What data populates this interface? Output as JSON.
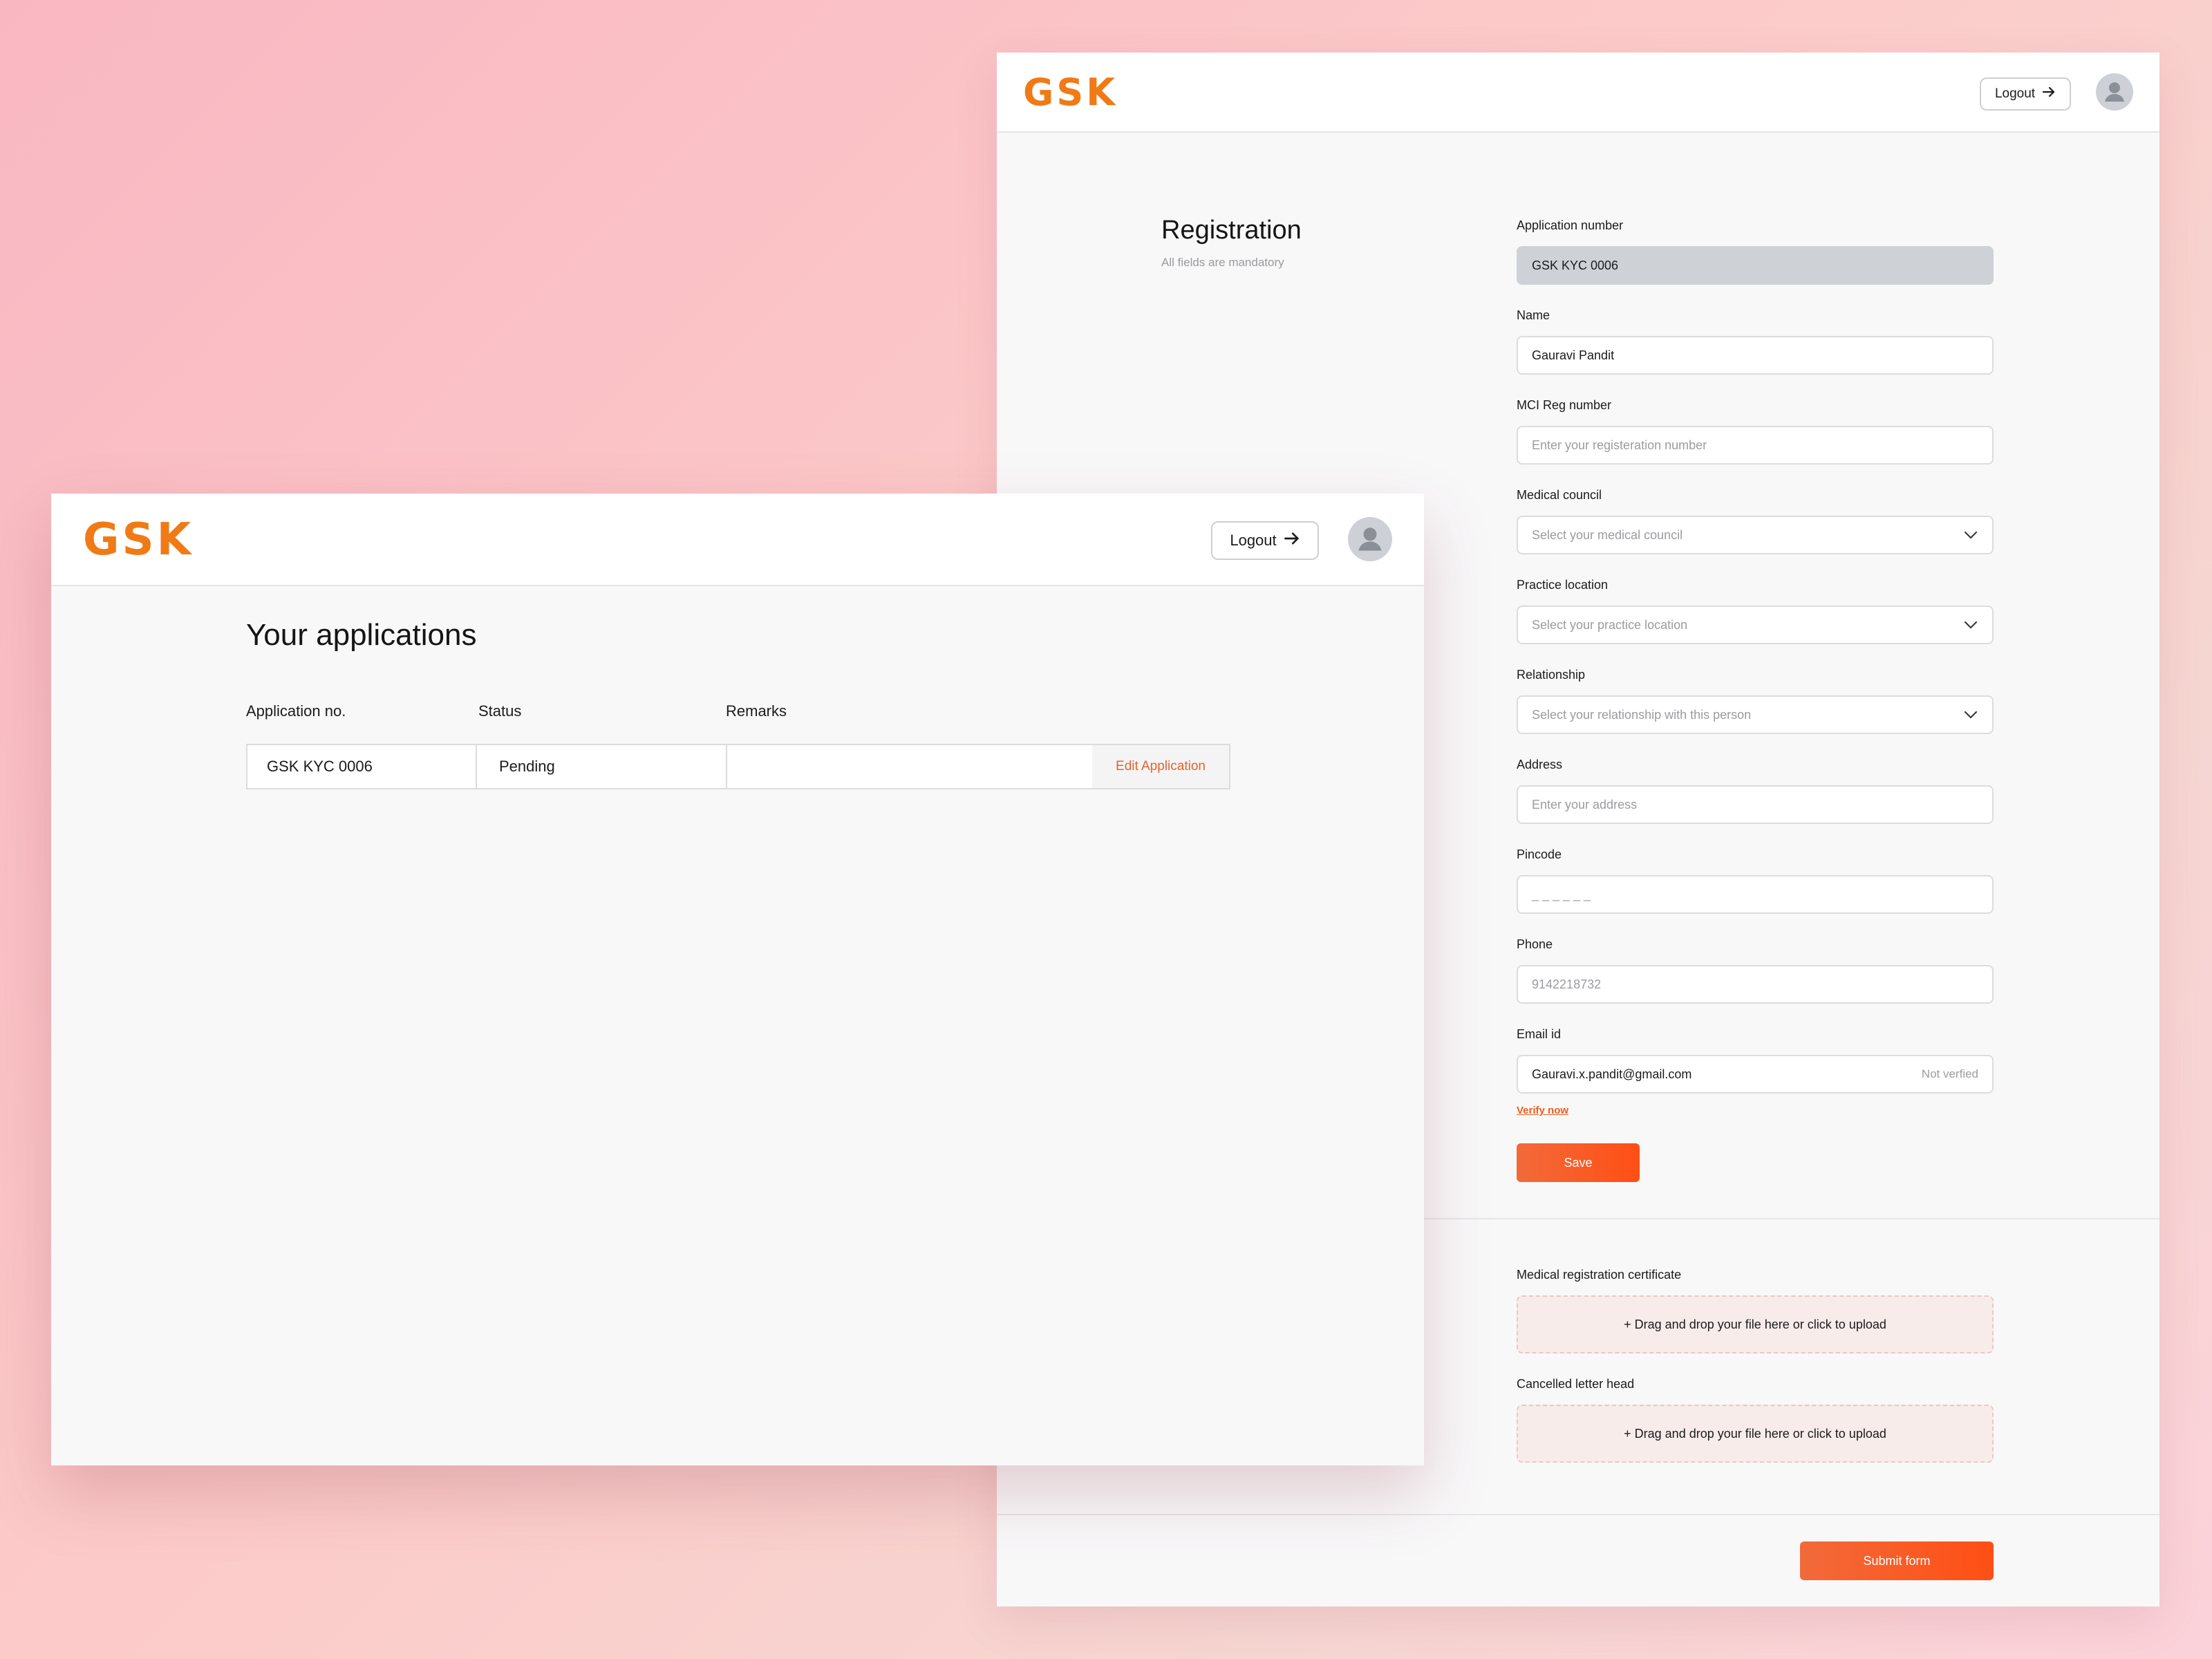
{
  "registration": {
    "brand": "GSK",
    "logout_label": "Logout",
    "title": "Registration",
    "subtitle": "All fields are mandatory",
    "fields": [
      {
        "label": "Application number",
        "value": "GSK KYC 0006"
      },
      {
        "label": "Name",
        "value": "Gauravi Pandit"
      },
      {
        "label": "MCI Reg number",
        "placeholder": "Enter your registeration number"
      },
      {
        "label": "Medical council",
        "placeholder": "Select your medical council"
      },
      {
        "label": "Practice location",
        "placeholder": "Select your practice location"
      },
      {
        "label": "Relationship",
        "placeholder": "Select your relationship with this person"
      },
      {
        "label": "Address",
        "placeholder": "Enter your address"
      },
      {
        "label": "Pincode",
        "placeholder": "_ _ _ _ _ _"
      },
      {
        "label": "Phone",
        "placeholder": "9142218732"
      },
      {
        "label": "Email id",
        "value": "Gauravi.x.pandit@gmail.com",
        "status": "Not verfied"
      }
    ],
    "verify_label": "Verify now",
    "save_label": "Save",
    "uploads": [
      {
        "label": "Medical registration certificate",
        "text": "+ Drag and drop your file here or click to upload"
      },
      {
        "label": "Cancelled letter head",
        "text": "+ Drag and drop your file here or click to upload"
      }
    ],
    "submit_label": "Submit form"
  },
  "applications": {
    "brand": "GSK",
    "logout_label": "Logout",
    "title": "Your applications",
    "columns": [
      "Application no.",
      "Status",
      "Remarks"
    ],
    "rows": [
      {
        "app_no": "GSK KYC 0006",
        "status": "Pending",
        "remarks": "",
        "action": "Edit Application"
      }
    ]
  },
  "colors": {
    "brand": "#f07a16",
    "accent": "#ff4f14",
    "link": "#e8612c"
  }
}
